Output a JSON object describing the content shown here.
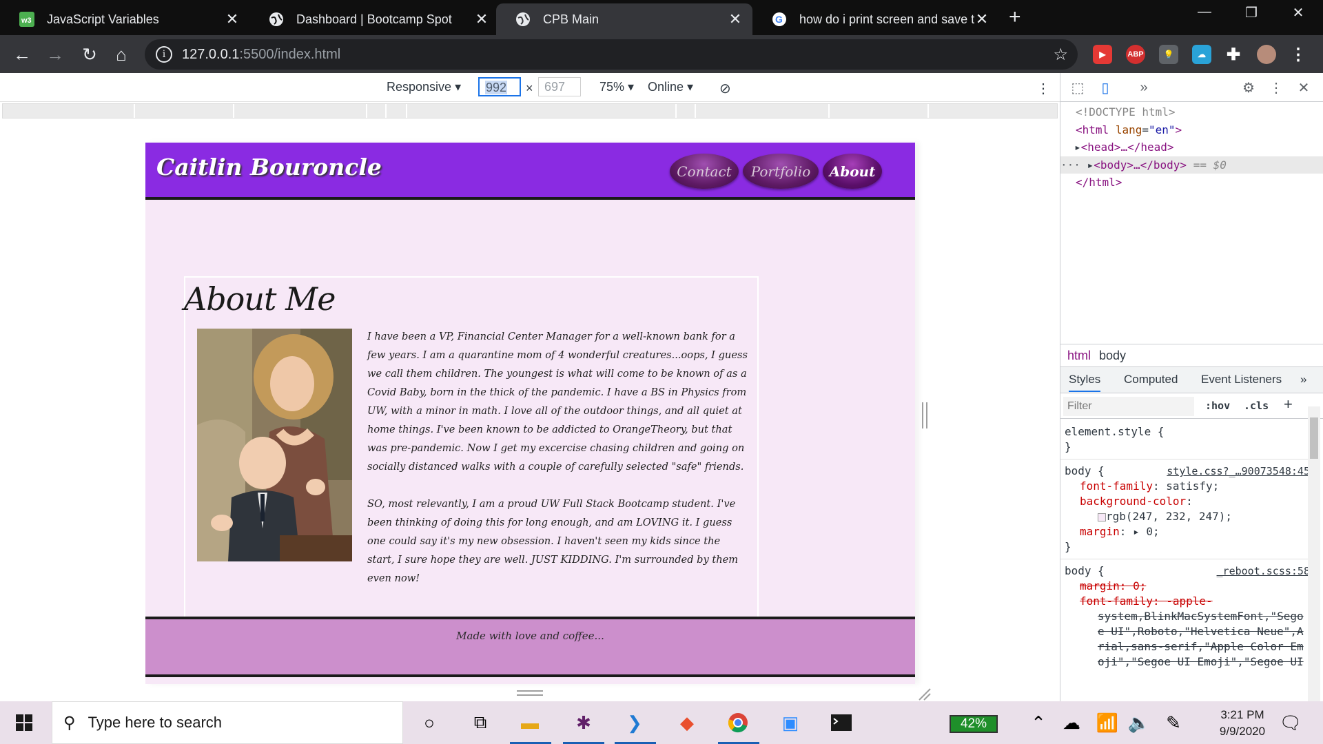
{
  "browser": {
    "tabs": [
      {
        "title": "JavaScript Variables",
        "icon": "w3schools-icon",
        "active": false
      },
      {
        "title": "Dashboard | Bootcamp Spot",
        "icon": "globe-icon",
        "active": false
      },
      {
        "title": "CPB Main",
        "icon": "globe-icon",
        "active": true
      },
      {
        "title": "how do i print screen and save to",
        "icon": "google-icon",
        "active": false
      }
    ],
    "close_glyph": "✕",
    "new_tab_glyph": "+",
    "url_host": "127.0.0.1",
    "url_path": ":5500/index.html",
    "extensions": [
      "ABP"
    ]
  },
  "device_toolbar": {
    "mode": "Responsive",
    "width": "992",
    "height": "697",
    "zoom": "75%",
    "network": "Online",
    "times": "×"
  },
  "site": {
    "brand": "Caitlin Bouroncle",
    "nav": [
      "Contact",
      "Portfolio",
      "About"
    ],
    "about_title": "About Me",
    "paragraph1": "I have been a VP, Financial Center Manager for a well-known bank for a few years. I am a quarantine mom of 4 wonderful creatures...oops, I guess we call them children. The youngest is what will come to be known of as a Covid Baby, born in the thick of the pandemic. I have a BS in Physics from UW, with a minor in math. I love all of the outdoor things, and all quiet at home things. I've been known to be addicted to OrangeTheory, but that was pre-pandemic. Now I get my excercise chasing children and going on socially distanced walks with a couple of carefully selected \"safe\" friends.",
    "paragraph2": "SO, most relevantly, I am a proud UW Full Stack Bootcamp student. I've been thinking of doing this for long enough, and am LOVING it. I guess one could say it's my new obsession. I haven't seen my kids since the start, I sure hope they are well. JUST KIDDING. I'm surrounded by them even now!",
    "footer": "Made with love and coffee...",
    "colors": {
      "header": "#8a2be2",
      "background": "#f7e8f7",
      "footer": "#cc8fcc"
    }
  },
  "devtools": {
    "dom": {
      "doctype": "<!DOCTYPE html>",
      "html_open_tag": "<html",
      "html_attr": "lang",
      "html_attr_val": "\"en\"",
      "html_close_bracket": ">",
      "head": "<head>…</head>",
      "body": "<body>…</body>",
      "selected_marker": "== $0",
      "html_close": "</html>",
      "ellipsis": "···"
    },
    "crumbs": [
      "html",
      "body"
    ],
    "panel_tabs": [
      "Styles",
      "Computed",
      "Event Listeners"
    ],
    "filter_placeholder": "Filter",
    "hov": ":hov",
    "cls": ".cls",
    "rules": {
      "element_style": "element.style {",
      "close_brace": "}",
      "body_selector": "body {",
      "body_src": "style.css?_…90073548:45",
      "font_family_prop": "font-family",
      "font_family_val": "satisfy;",
      "bg_prop": "background-color",
      "bg_val": "rgb(247, 232, 247);",
      "margin_prop": "margin",
      "margin_val": "0;",
      "reboot_selector": "body {",
      "reboot_src": "_reboot.scss:58",
      "reboot_margin": "margin: 0;",
      "reboot_font_prop": "font-family: -apple-",
      "reboot_font_val": "system,BlinkMacSystemFont,\"Segoe UI\",Roboto,\"Helvetica Neue\",Arial,sans-serif,\"Apple Color Emoji\",\"Segoe UI Emoji\",\"Segoe UI"
    }
  },
  "taskbar": {
    "search_placeholder": "Type here to search",
    "battery": "42%",
    "time": "3:21 PM",
    "date": "9/9/2020"
  }
}
